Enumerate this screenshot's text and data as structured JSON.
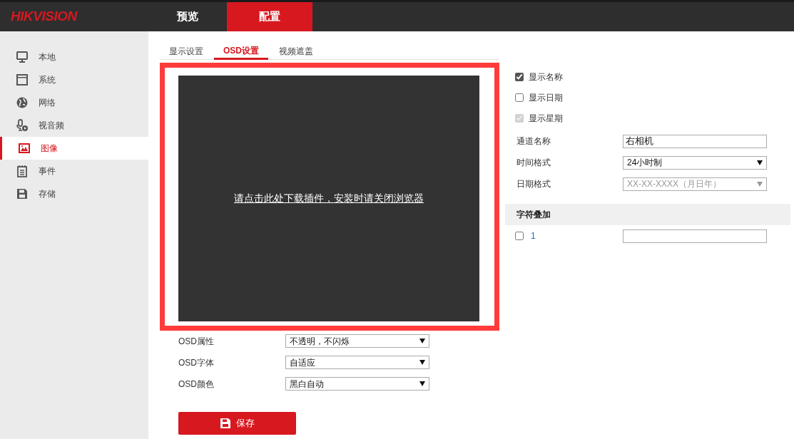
{
  "header": {
    "logo": "HIKVISION",
    "nav": [
      {
        "label": "预览",
        "selected": false
      },
      {
        "label": "配置",
        "selected": true
      }
    ]
  },
  "sidebar": {
    "items": [
      {
        "label": "本地",
        "kind": "monitor",
        "selected": false
      },
      {
        "label": "系统",
        "kind": "window",
        "selected": false
      },
      {
        "label": "网络",
        "kind": "globe",
        "selected": false
      },
      {
        "label": "视音频",
        "kind": "mic",
        "selected": false
      },
      {
        "label": "图像",
        "kind": "image",
        "selected": true
      },
      {
        "label": "事件",
        "kind": "notepad",
        "selected": false
      },
      {
        "label": "存储",
        "kind": "disk",
        "selected": false
      }
    ]
  },
  "tabs": [
    {
      "label": "显示设置",
      "selected": false
    },
    {
      "label": "OSD设置",
      "selected": true
    },
    {
      "label": "视频遮盖",
      "selected": false
    }
  ],
  "preview": {
    "link": "请点击此处下载插件，安装时请关闭浏览器"
  },
  "options": [
    {
      "label": "显示名称",
      "checked": true,
      "disabled": false
    },
    {
      "label": "显示日期",
      "checked": false,
      "disabled": false
    },
    {
      "label": "显示星期",
      "checked": true,
      "disabled": true
    }
  ],
  "fields": [
    {
      "label": "通道名称",
      "kind": "text",
      "value": "右相机",
      "disabled": false
    },
    {
      "label": "时间格式",
      "kind": "select",
      "value": "24小时制",
      "disabled": false
    },
    {
      "label": "日期格式",
      "kind": "select",
      "value": "XX-XX-XXXX（月日年）",
      "disabled": true
    }
  ],
  "overlay": {
    "title": "字符叠加",
    "rows": [
      {
        "label": "1",
        "checked": false
      }
    ]
  },
  "osd_fields": [
    {
      "label": "OSD属性",
      "value": "不透明，不闪烁"
    },
    {
      "label": "OSD字体",
      "value": "自适应"
    },
    {
      "label": "OSD颜色",
      "value": "黑白自动"
    }
  ],
  "save_button": "保存"
}
